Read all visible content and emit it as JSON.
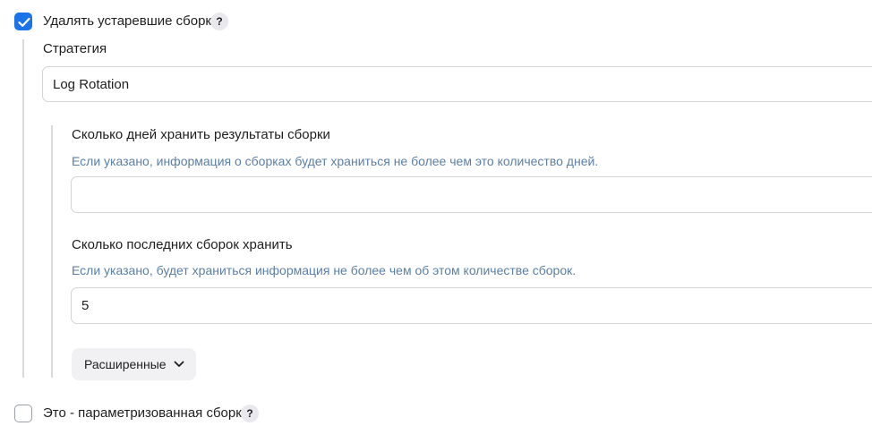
{
  "discard_old_builds": {
    "checked": true,
    "label": "Удалять устаревшие сборки",
    "help": "?"
  },
  "strategy": {
    "label": "Стратегия",
    "selected": "Log Rotation"
  },
  "days_to_keep": {
    "label": "Сколько дней хранить результаты сборки",
    "description": "Если указано, информация о сборках будет храниться не более чем это количество дней.",
    "value": ""
  },
  "num_to_keep": {
    "label": "Сколько последних сборок хранить",
    "description": "Если указано, будет храниться информация не более чем об этом количестве сборок.",
    "value": "5"
  },
  "advanced": {
    "label": "Расширенные"
  },
  "parameterized": {
    "checked": false,
    "label": "Это - параметризованная сборка",
    "help": "?"
  },
  "colors": {
    "accent": "#1a73e8",
    "description_text": "#5b7fa6"
  }
}
